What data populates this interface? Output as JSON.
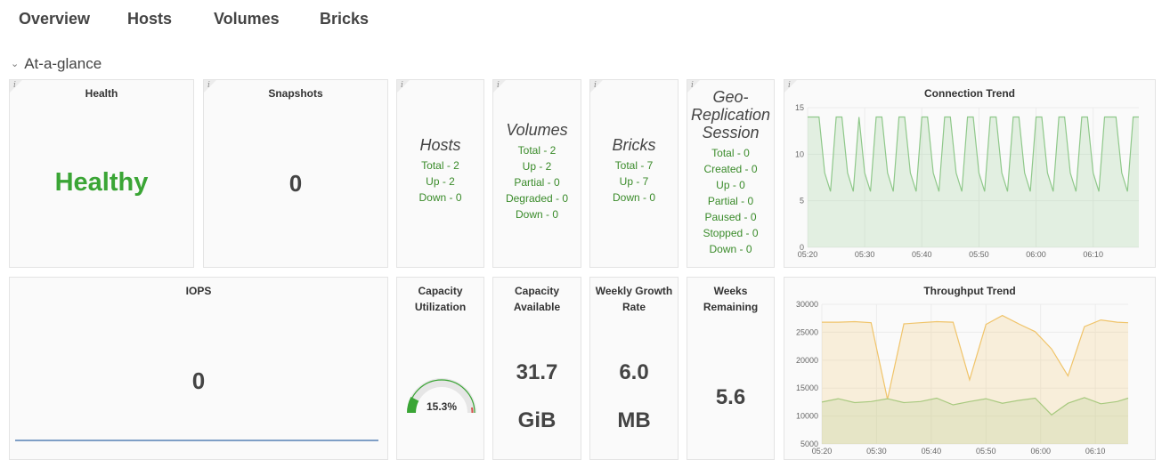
{
  "tabs": [
    "Overview",
    "Hosts",
    "Volumes",
    "Bricks"
  ],
  "section": {
    "label": "At-a-glance"
  },
  "info_glyph": "i",
  "panels": {
    "health": {
      "title": "Health",
      "value": "Healthy"
    },
    "snapshots": {
      "title": "Snapshots",
      "value": "0"
    },
    "hosts": {
      "title": "Hosts",
      "lines": [
        "Total - 2",
        "Up - 2",
        "Down - 0"
      ]
    },
    "volumes": {
      "title": "Volumes",
      "lines": [
        "Total - 2",
        "Up - 2",
        "Partial - 0",
        "Degraded - 0",
        "Down - 0"
      ]
    },
    "bricks": {
      "title": "Bricks",
      "lines": [
        "Total - 7",
        "Up - 7",
        "Down - 0"
      ]
    },
    "geo": {
      "title_lines": [
        "Geo-",
        "Replication",
        "Session"
      ],
      "lines": [
        "Total - 0",
        "Created - 0",
        "Up - 0",
        "Partial - 0",
        "Paused - 0",
        "Stopped - 0",
        "Down - 0"
      ]
    },
    "iops": {
      "title": "IOPS",
      "value": "0"
    },
    "capacity_utilization": {
      "title_lines": [
        "Capacity",
        "Utilization"
      ],
      "value": "15.3%",
      "fraction": 0.153
    },
    "capacity_available": {
      "title_lines": [
        "Capacity",
        "Available"
      ],
      "value": "31.7",
      "unit": "GiB"
    },
    "weekly_growth": {
      "title_lines": [
        "Weekly Growth",
        "Rate"
      ],
      "value": "6.0",
      "unit": "MB"
    },
    "weeks_remaining": {
      "title_lines": [
        "Weeks",
        "Remaining"
      ],
      "value": "5.6"
    }
  },
  "colors": {
    "healthy": "#3aa535",
    "stat_green": "#3a8b2a",
    "connection_line": "#8fc88a",
    "throughput_orange": "#f0c46a",
    "throughput_green": "#a8c97f",
    "iops_line": "#7f9fc6",
    "gauge_red": "#d9534f",
    "gauge_green": "#3aa535"
  },
  "chart_data": [
    {
      "type": "area",
      "title": "Connection Trend",
      "xlabel": "",
      "ylabel": "",
      "ylim": [
        0,
        15
      ],
      "yticks": [
        0,
        5,
        10,
        15
      ],
      "xticks": [
        "05:20",
        "05:30",
        "05:40",
        "05:50",
        "06:00",
        "06:10"
      ],
      "x_minutes_start": 0,
      "x_minutes_end": 58,
      "series": [
        {
          "x": [
            0,
            1,
            2,
            3,
            4,
            5,
            6,
            7,
            8,
            9,
            10,
            11,
            12,
            13,
            14,
            15,
            16,
            17,
            18,
            19,
            20,
            21,
            22,
            23,
            24,
            25,
            26,
            27,
            28,
            29,
            30,
            31,
            32,
            33,
            34,
            35,
            36,
            37,
            38,
            39,
            40,
            41,
            42,
            43,
            44,
            45,
            46,
            47,
            48,
            49,
            50,
            51,
            52,
            53,
            54,
            55,
            56,
            57,
            58
          ],
          "y": [
            14,
            14,
            14,
            8,
            6,
            14,
            14,
            8,
            6,
            14,
            8,
            6,
            14,
            14,
            8,
            6,
            14,
            14,
            8,
            6,
            14,
            14,
            8,
            6,
            14,
            14,
            8,
            6,
            14,
            14,
            8,
            6,
            14,
            14,
            8,
            6,
            14,
            14,
            8,
            6,
            14,
            14,
            8,
            6,
            14,
            14,
            8,
            6,
            14,
            14,
            8,
            6,
            14,
            14,
            14,
            8,
            6,
            14,
            14
          ]
        }
      ]
    },
    {
      "type": "area",
      "title": "Throughput Trend",
      "xlabel": "",
      "ylabel": "",
      "ylim": [
        5000,
        30000
      ],
      "yticks": [
        5000,
        10000,
        15000,
        20000,
        25000,
        30000
      ],
      "xticks": [
        "05:20",
        "05:30",
        "05:40",
        "05:50",
        "06:00",
        "06:10"
      ],
      "x_minutes_start": 0,
      "x_minutes_end": 56,
      "series": [
        {
          "x": [
            0,
            3,
            6,
            9,
            12,
            15,
            18,
            21,
            24,
            27,
            30,
            33,
            36,
            39,
            42,
            45,
            48,
            51,
            54,
            56
          ],
          "y": [
            26800,
            26800,
            26900,
            26700,
            13000,
            26500,
            26700,
            26900,
            26800,
            16500,
            26400,
            28000,
            26500,
            25100,
            22000,
            17200,
            26000,
            27200,
            26800,
            26700
          ]
        },
        {
          "x": [
            0,
            3,
            6,
            9,
            12,
            15,
            18,
            21,
            24,
            27,
            30,
            33,
            36,
            39,
            42,
            45,
            48,
            51,
            54,
            56
          ],
          "y": [
            12500,
            13100,
            12400,
            12600,
            13100,
            12400,
            12600,
            13200,
            12000,
            12600,
            13100,
            12300,
            12800,
            13200,
            10200,
            12300,
            13300,
            12200,
            12600,
            13200
          ]
        }
      ]
    }
  ]
}
